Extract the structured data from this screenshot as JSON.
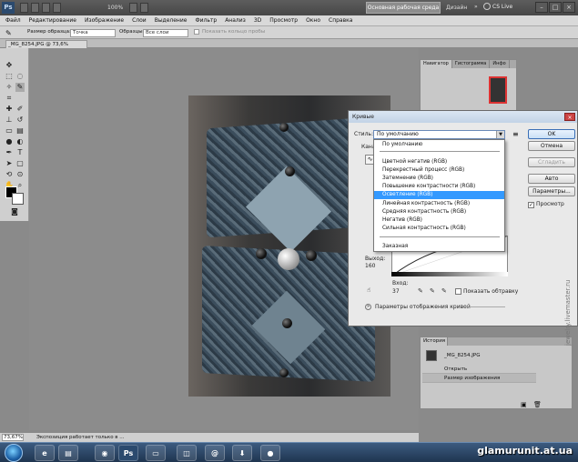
{
  "titlebar": {
    "logo": "Ps",
    "zoom": "100%",
    "workspace": "Основная рабочая среда",
    "design": "Дизайн",
    "cslive": "CS Live"
  },
  "menu": [
    "Файл",
    "Редактирование",
    "Изображение",
    "Слои",
    "Выделение",
    "Фильтр",
    "Анализ",
    "3D",
    "Просмотр",
    "Окно",
    "Справка"
  ],
  "options": {
    "sample_size_label": "Размер образца:",
    "sample_size_value": "Точка",
    "samples_label": "Образцы:",
    "samples_value": "Все слои",
    "show_ring": "Показать кольцо пробы"
  },
  "document": {
    "tab_label": "_MG_8254.JPG @ 73,6% (RGB/8) *"
  },
  "navigator": {
    "tabs": [
      "Навигатор",
      "Гистограмма",
      "Инфо"
    ]
  },
  "curves": {
    "title": "Кривые",
    "style_label": "Стиль:",
    "style_value": "По умолчанию",
    "channel_label": "Кана",
    "buttons": {
      "ok": "OK",
      "cancel": "Отмена",
      "smooth": "Сгладить",
      "auto": "Авто",
      "options": "Параметры..."
    },
    "preview_label": "Просмотр",
    "output_label": "Выход:",
    "output_value": "160",
    "input_label": "Вход:",
    "input_value": "37",
    "show_clipping": "Показать обтравку",
    "curve_display_options": "Параметры отображения кривой",
    "dropdown": {
      "top": "По умолчанию",
      "items": [
        "Цветной негатив (RGB)",
        "Перекрестный процесс (RGB)",
        "Затемнение (RGB)",
        "Повышение контрастности (RGB)",
        "Осветление (RGB)",
        "Линейная контрастность (RGB)",
        "Средняя контрастность (RGB)",
        "Негатив (RGB)",
        "Сильная контрастность (RGB)"
      ],
      "selected_index": 4,
      "custom": "Заказная"
    }
  },
  "history": {
    "tab": "История",
    "snapshot": "_MG_8254.JPG",
    "steps": [
      "Открыть",
      "Размер изображения"
    ]
  },
  "status": {
    "zoom": "73,67%",
    "text": "Экспозиция работает только в ..."
  },
  "watermarks": {
    "site": "glamurunit.at.ua",
    "side": "jewelry.livemaster.ru"
  }
}
